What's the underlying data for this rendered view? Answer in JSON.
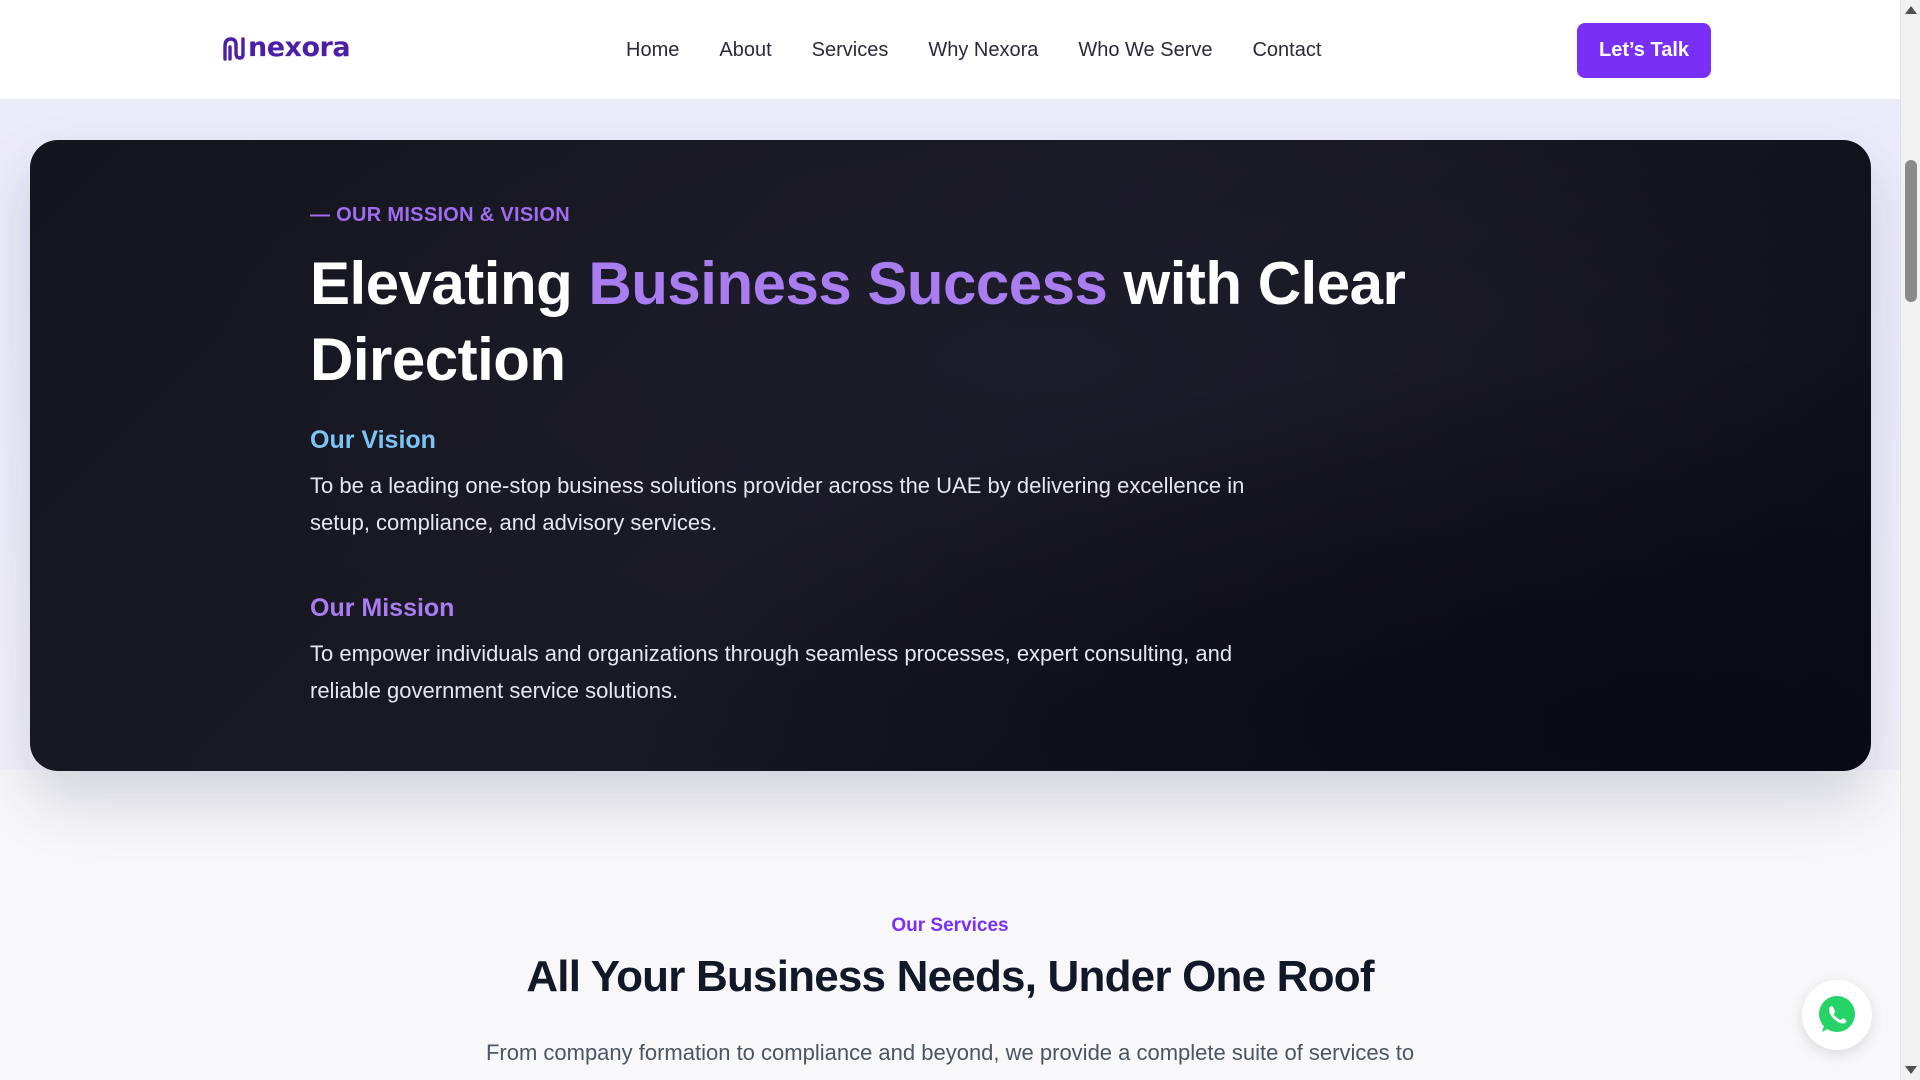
{
  "header": {
    "logo_text": "nexora",
    "nav": [
      "Home",
      "About",
      "Services",
      "Why Nexora",
      "Who We Serve",
      "Contact"
    ],
    "cta_label": "Let’s Talk"
  },
  "hero": {
    "eyebrow": "— OUR MISSION & VISION",
    "title_before": "Elevating ",
    "title_accent": "Business Success",
    "title_after": " with Clear Direction",
    "vision_heading": "Our Vision",
    "vision_text": "To be a leading one-stop business solutions provider across the UAE by delivering excellence in setup, compliance, and advisory services.",
    "mission_heading": "Our Mission",
    "mission_text": "To empower individuals and organizations through seamless processes, expert consulting, and reliable government service solutions."
  },
  "services": {
    "eyebrow": "Our Services",
    "title": "All Your Business Needs, Under One Roof",
    "description": "From company formation to compliance and beyond, we provide a complete suite of services to"
  },
  "colors": {
    "brand": "#7a2ff7",
    "accent_purple": "#a97cf0",
    "accent_blue": "#7cc4f5",
    "hero_bg": "#15151d",
    "whatsapp": "#25d366"
  },
  "icons": {
    "whatsapp": "whatsapp-icon",
    "logo": "nexora-logo-mark"
  }
}
